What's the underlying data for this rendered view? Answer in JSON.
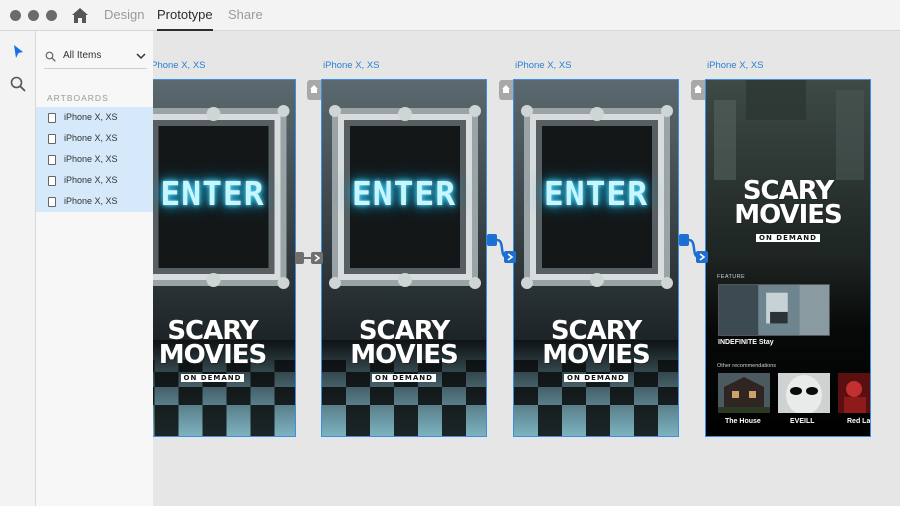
{
  "window": {
    "tabs": [
      {
        "label": "Design"
      },
      {
        "label": "Prototype"
      },
      {
        "label": "Share"
      }
    ],
    "active_tab": "Prototype"
  },
  "tools": [
    "select-arrow-icon",
    "zoom-icon"
  ],
  "layers_panel": {
    "filter_label": "All Items",
    "section_title": "ARTBOARDS",
    "items": [
      {
        "label": "iPhone X, XS"
      },
      {
        "label": "iPhone X, XS"
      },
      {
        "label": "iPhone X, XS"
      },
      {
        "label": "iPhone X, XS"
      },
      {
        "label": "iPhone X, XS"
      }
    ]
  },
  "artboards": [
    {
      "label": "iPhone X, XS",
      "enter_text": "ENTER",
      "logo": [
        "SCARY",
        "MOVIES",
        "ON DEMAND"
      ]
    },
    {
      "label": "iPhone X, XS",
      "enter_text": "ENTER",
      "logo": [
        "SCARY",
        "MOVIES",
        "ON DEMAND"
      ]
    },
    {
      "label": "iPhone X, XS",
      "enter_text": "ENTER",
      "logo": [
        "SCARY",
        "MOVIES",
        "ON DEMAND"
      ]
    },
    {
      "label": "iPhone X, XS",
      "logo": [
        "SCARY",
        "MOVIES",
        "ON DEMAND"
      ],
      "feature_heading": "FEATURE",
      "feature_title": "INDEFINITE Stay",
      "other_heading": "Other recommendations",
      "recommendations": [
        {
          "title": "The House"
        },
        {
          "title": "EVEILL"
        },
        {
          "title": "Red La"
        }
      ]
    }
  ],
  "colors": {
    "selection_blue": "#3d8ee0",
    "wire_blue": "#2d7fd2",
    "neon": "#5fe0ff"
  }
}
